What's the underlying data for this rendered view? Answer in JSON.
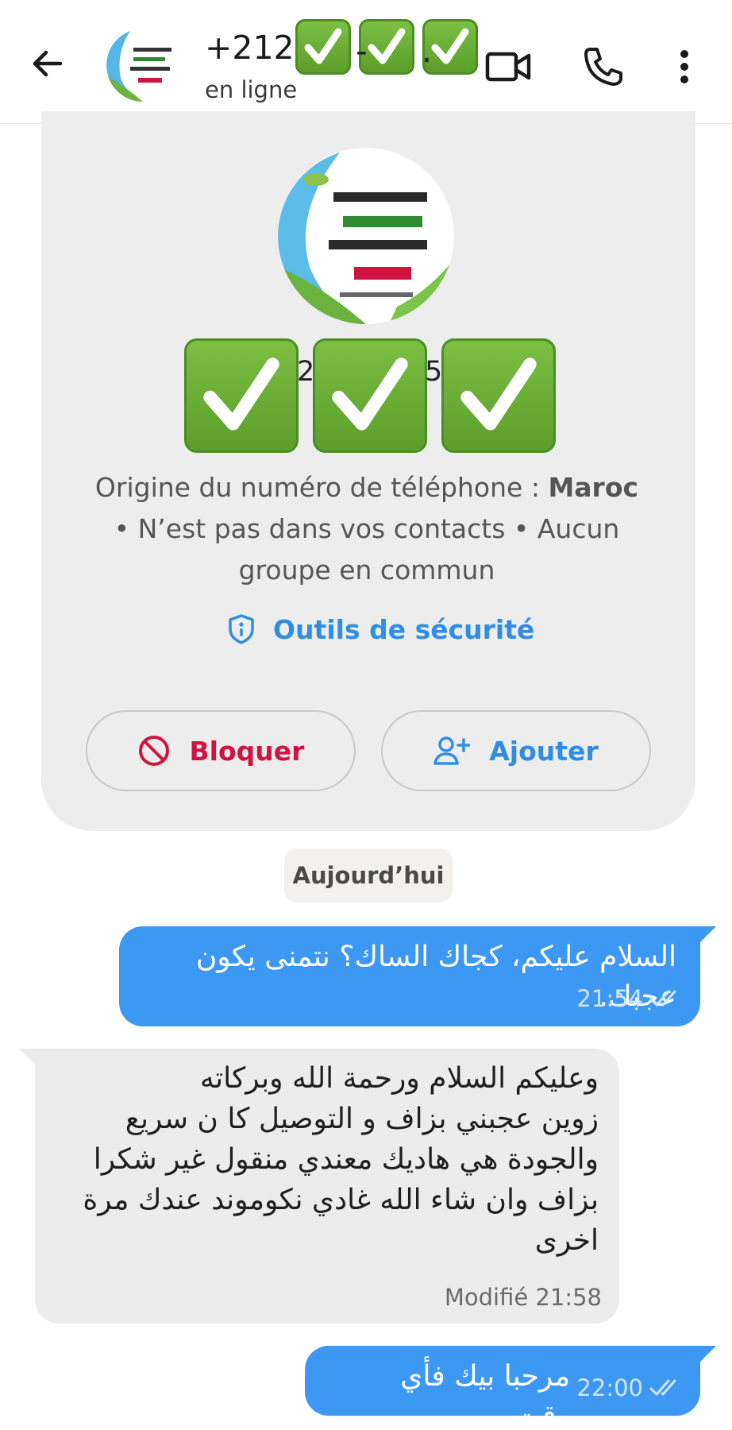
{
  "header": {
    "title": "+212 (",
    "title_sep": "-",
    "title_tail": ".",
    "status": "en ligne"
  },
  "profile": {
    "digit1": "2",
    "digit2": "5",
    "origin_label": "Origine du numéro de téléphone : ",
    "origin_country": "Maroc",
    "origin_rest": "• N’est pas dans vos contacts • Aucun groupe en commun",
    "security_label": "Outils de sécurité",
    "block_label": "Bloquer",
    "add_label": "Ajouter"
  },
  "date_chip": "Aujourd’hui",
  "messages": [
    {
      "text": "السلام عليكم، كجاك الساك؟ نتمنى يكون عجبك.",
      "time": "21:54"
    },
    {
      "text": "وعليكم السلام ورحمة الله وبركاته\nزوين عجبني بزاف  و التوصيل كا ن سريع\nوالجودة هي  هاديك معندي منقول  غير شكرا\nبزاف وان شاء الله غادي نكوموند عندك مرة\nاخرى",
      "time": "Modifié 21:58"
    },
    {
      "text": "مرحبا بيك فأي وقت.",
      "time": "22:00"
    }
  ],
  "colors": {
    "accent": "#2f8de4",
    "block": "#d0143f",
    "outgoing": "#3d98f4",
    "incoming": "#ececec",
    "card": "#ededed",
    "check_green": "#6cae35"
  },
  "icons": [
    "back-arrow-icon",
    "video-call-icon",
    "phone-icon",
    "more-vert-icon",
    "shield-icon",
    "block-icon",
    "add-person-icon",
    "double-check-icon",
    "check-mark-emoji-icon"
  ]
}
